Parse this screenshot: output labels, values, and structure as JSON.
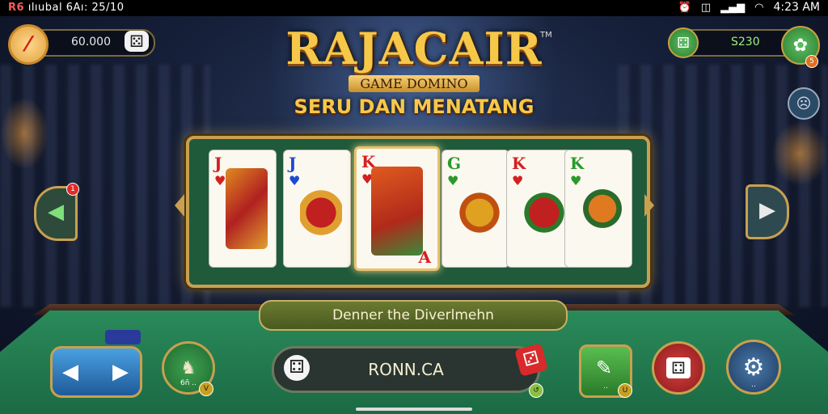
{
  "status_bar": {
    "left_red": "R6",
    "left_text": "ılıubal  6Aı:  25/10",
    "time": "4:23 AM"
  },
  "top_left": {
    "coins": "60.000"
  },
  "top_right": {
    "balance": "S230",
    "badge": "5"
  },
  "logo": {
    "main": "RAJACAIR",
    "tm": "TM",
    "sub": "GAME DOMINO",
    "tagline": "SERU DAN MENATANG"
  },
  "cards": [
    {
      "rank": "J",
      "suit": "♥",
      "suit_color": "#d42020"
    },
    {
      "rank": "J",
      "suit": "♥",
      "suit_color": "#1a4ad4"
    },
    {
      "rank": "K",
      "suit": "♥",
      "suit_color": "#d42020",
      "corner": "A"
    },
    {
      "rank": "G",
      "suit": "♥",
      "suit_color": "#2a9a2a"
    },
    {
      "rank": "K",
      "suit": "♥",
      "suit_color": "#d42020"
    },
    {
      "rank": "K",
      "suit": "♥",
      "suit_color": "#2a9a2a"
    }
  ],
  "side": {
    "left_badge": "1"
  },
  "banner": "Denner the Diverlmehn",
  "player": {
    "name": "RONN.CA"
  },
  "buttons": {
    "green_label": "6ñ ..",
    "green_badge": "V",
    "square_label": "..",
    "square_badge": "U",
    "gear_label": ".."
  },
  "colors": {
    "gold": "#c8a050",
    "felt": "#1f5a3a",
    "accent_red": "#d42020"
  },
  "icons": [
    "avatar-icon",
    "dice-icon",
    "gear-icon",
    "arrow-left-icon",
    "arrow-right-icon",
    "wifi-icon",
    "signal-icon",
    "alarm-icon"
  ]
}
